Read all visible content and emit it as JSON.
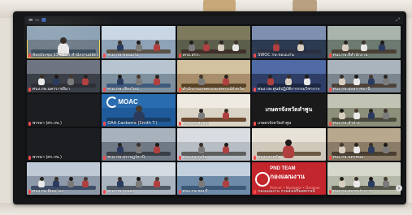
{
  "window": {
    "titlebar_icons": [
      "minimize-icon",
      "restore-icon",
      "grid-view-icon"
    ],
    "right_icon": "⤢"
  },
  "tiles": [
    {
      "label": "ห้องประชุม 134-135 สำนักงานปลัดกระทรวง",
      "active": true,
      "bg": "#6b7a86",
      "wall": "#8aa0b2",
      "desk": "#3a4a5a",
      "people": 1
    },
    {
      "label": "ศนง.กษ.ขอนแก่น",
      "bg": "#8fa3b8",
      "wall": "#c9d6e3",
      "desk": "#5a5246",
      "people": 3
    },
    {
      "label": "สกอ.สกก.",
      "bg": "#5a5e4a",
      "wall": "#7d7a5e",
      "desk": "#3f2f2a",
      "people": 4
    },
    {
      "label": "SWOC กษ.ขอนแก่น",
      "bg": "#2c3a52",
      "wall": "#7e8fb0",
      "desk": "#2a2f40",
      "people": 2
    },
    {
      "label": "ศนง.กษ.ที่สำนักงาน",
      "bg": "#6c7a70",
      "wall": "#a9b5ac",
      "desk": "#4a4034",
      "people": 3
    },
    {
      "label": "ศนง.กษ.นครราชสีมา",
      "bg": "#3a3f48",
      "wall": "#6e7480",
      "desk": "#2d2f35",
      "people": 4
    },
    {
      "label": "ศนง.กษ.เชียงใหม่",
      "bg": "#7e8f9e",
      "wall": "#b7c5d0",
      "desk": "#3d5a7a",
      "people": 3
    },
    {
      "label": "สำนักงานเกษตรและสหกรณ์จังหวัด",
      "bg": "#a88e6a",
      "wall": "#d3c2a0",
      "desk": "#5a4226",
      "people": 2
    },
    {
      "label": "ศนง.กษ.ศูนย์ปฏิบัติการกรมวิชาการ",
      "bg": "#2e3e66",
      "wall": "#4f6aa5",
      "desk": "#1d2640",
      "people": 3
    },
    {
      "label": "ศนง.กษ.อุบลราชธานี",
      "bg": "#7b8690",
      "wall": "#aab4bd",
      "desk": "#4e4238",
      "people": 4
    },
    {
      "label": "พรรษา (ศก.กษ.)",
      "plain": true,
      "bg": "#1c1d20",
      "people": 0
    },
    {
      "label": "OAA Canberra (Smith T.)",
      "moac": true,
      "bg": "#1f5b9a",
      "wall": "#2a6cb0",
      "desk": "#173e68",
      "people": 1
    },
    {
      "label": "ศนง.กษ.สงขลา",
      "bg": "#d9d3c6",
      "wall": "#eeeae2",
      "desk": "#6a4a30",
      "people": 2
    },
    {
      "label": "เกษตรจังหวัดลำพูน",
      "kaset": true,
      "bg": "#1a1a1a",
      "people": 0
    },
    {
      "label": "ศนง.กษ.ลำปาง",
      "bg": "#8c8f7a",
      "wall": "#c2c4b3",
      "desk": "#4c4a3c",
      "people": 4
    },
    {
      "label": "พรรษา (ศก.กษ.)",
      "plain": true,
      "bg": "#1c1d20",
      "people": 0
    },
    {
      "label": "ศนง.กษ.สุราษฎร์ธานี",
      "bg": "#6f7a86",
      "wall": "#a7b2bd",
      "desk": "#3a3f46",
      "people": 3
    },
    {
      "label": "ศนง.กษ.ภูเก็ต",
      "bg": "#b7bdc4",
      "wall": "#d9dde2",
      "desk": "#5e5e5e",
      "people": 2
    },
    {
      "label": "ศนง.กษ.ตรัง",
      "bg": "#cfc8bb",
      "wall": "#e7e2d8",
      "desk": "#6a5a44",
      "people": 1
    },
    {
      "label": "ศนง.กษ.นครพนม",
      "bg": "#8a7c66",
      "wall": "#b8a98e",
      "desk": "#4a3e30",
      "people": 4
    },
    {
      "label": "ศนง.กษ.พิษณุโลก",
      "bg": "#8d98a8",
      "wall": "#bfc9d6",
      "desk": "#3d4d66",
      "people": 4
    },
    {
      "label": "ศนง.กษ.ระยอง",
      "bg": "#a9b4bf",
      "wall": "#d4dbe2",
      "desk": "#4f5966",
      "people": 3
    },
    {
      "label": "ศนง.กษ.ชลบุรี",
      "bg": "#6d8aa8",
      "wall": "#c3d1df",
      "desk": "#3b5878",
      "people": 2
    },
    {
      "label": "กองแผนงาน กรมส่งเสริมสหกรณ์",
      "pnd": true,
      "bg": "#c3262c",
      "people": 0
    },
    {
      "label": "ศนง.กษ.สมุทรปราการ",
      "bg": "#b5b9a8",
      "wall": "#d6d8cb",
      "desk": "#55584a",
      "people": 4
    }
  ],
  "moac_label": "MOAC",
  "pnd": {
    "title_line1": "PND TEAM",
    "title_line2": "กองแผนงาน",
    "tagline": "Partner • Navigator • Designer"
  },
  "kaset_text": "เกษตรจังหวัดลำพูน"
}
